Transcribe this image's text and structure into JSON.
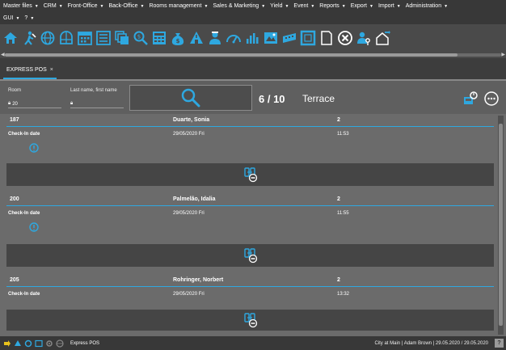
{
  "menu": {
    "row1": [
      "Master files",
      "CRM",
      "Front-Office",
      "Back-Office",
      "Rooms management",
      "Sales & Marketing",
      "Yield",
      "Event",
      "Reports",
      "Export",
      "Import",
      "Administration"
    ],
    "row2": [
      "GUI",
      "?"
    ]
  },
  "toolbar": {
    "icons": [
      "home-back-icon",
      "walk-in-icon",
      "globe-icon",
      "world-grid-icon",
      "calendar-icon",
      "list-icon",
      "multi-window-icon",
      "search-money-icon",
      "cash-register-icon",
      "money-bag-icon",
      "housekeeping-icon",
      "staff-icon",
      "speedometer-icon",
      "bar-chart-icon",
      "map-icon",
      "keyboard-icon",
      "frame-icon",
      "document-icon",
      "cancel-icon",
      "user-key-icon",
      "house-arrow-icon"
    ],
    "accent": "#2ea8e0"
  },
  "tab": {
    "label": "EXPRESS POS",
    "close": "×"
  },
  "filter": {
    "room_label": "Room",
    "room_value": "20",
    "name_label": "Last name, first name",
    "name_value": "",
    "counter": "6 / 10",
    "location": "Terrace"
  },
  "entries": [
    {
      "room": "187",
      "name": "Duarte, Sonia",
      "guests": "2",
      "label": "Check-In date",
      "date": "29/05/2020 Fri",
      "time": "11:53"
    },
    {
      "room": "200",
      "name": "Palmelão, Idalia",
      "guests": "2",
      "label": "Check-In date",
      "date": "29/05/2020 Fri",
      "time": "11:55"
    },
    {
      "room": "205",
      "name": "Rohringer, Norbert",
      "guests": "2",
      "label": "Check-In date",
      "date": "29/05/2020 Fri",
      "time": "13:32"
    }
  ],
  "status": {
    "module": "Express POS",
    "info": "City at Main | Adam Brown | 29.05.2020 / 29.05.2020",
    "corner": "?"
  }
}
